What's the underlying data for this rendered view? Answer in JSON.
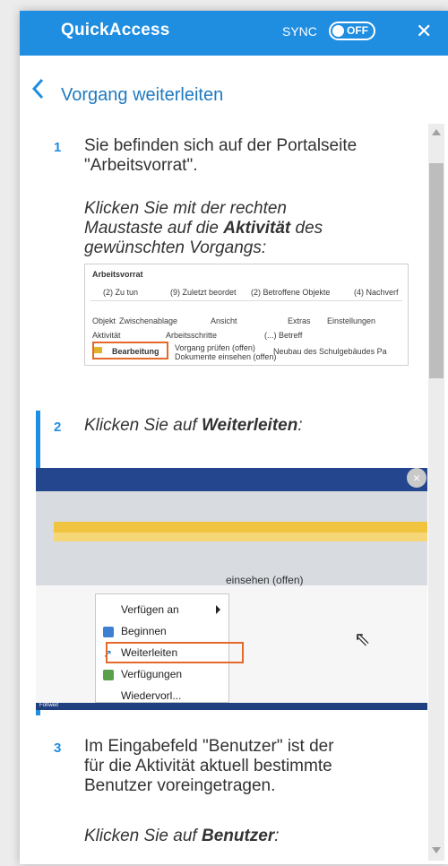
{
  "header": {
    "title": "QuickAccess",
    "sync_label": "SYNC",
    "toggle_state": "OFF",
    "close_icon": "close-icon",
    "colors": {
      "primary": "#1f8de0",
      "link": "#1f7ac0",
      "highlight": "#e56a2a"
    }
  },
  "nav": {
    "back_icon": "chevron-left-icon",
    "title": "Vorgang weiterleiten"
  },
  "steps": [
    {
      "number": "1",
      "lines": [
        "Sie befinden sich auf der Portalseite",
        "\"Arbeitsvorrat\"."
      ],
      "instruction_lines": [
        "Klicken Sie mit der rechten",
        "Maustaste auf die ",
        "Aktivität",
        " des",
        "gewünschten Vorgangs:"
      ]
    },
    {
      "number": "2",
      "instruction_prefix": "Klicken Sie auf ",
      "instruction_bold": "Weiterleiten",
      "instruction_suffix": ":"
    },
    {
      "number": "3",
      "lines": [
        "Im Eingabefeld \"Benutzer\" ist der",
        "für die Aktivität aktuell bestimmte",
        "Benutzer voreingetragen."
      ],
      "instruction_prefix": "Klicken Sie auf ",
      "instruction_bold": "Benutzer",
      "instruction_suffix": ":"
    }
  ],
  "screenshot1": {
    "title": "Arbeitsvorrat",
    "tabs": [
      "(2) Zu tun",
      "(9) Zuletzt beordet",
      "(2) Betroffene Objekte",
      "(4) Nachverf"
    ],
    "toolbar": [
      "Objekt",
      "Zwischenablage",
      "Ansicht",
      "Extras",
      "Einstellungen"
    ],
    "columns": [
      "Aktivität",
      "Arbeitsschritte",
      "(...) Betreff"
    ],
    "row_activity": "Bearbeitung",
    "row_steps": [
      "Vorgang prüfen (offen)",
      "Dokumente einsehen (offen)"
    ],
    "row_subject": "Neubau des Schulgebäudes Pa"
  },
  "screenshot2": {
    "menu_items": [
      "Verfügen an",
      "Beginnen",
      "Weiterleiten",
      "Verfügungen",
      "Wiedervorl..."
    ],
    "bg_label": "einsehen (offen)",
    "footer": "Fohweit"
  }
}
